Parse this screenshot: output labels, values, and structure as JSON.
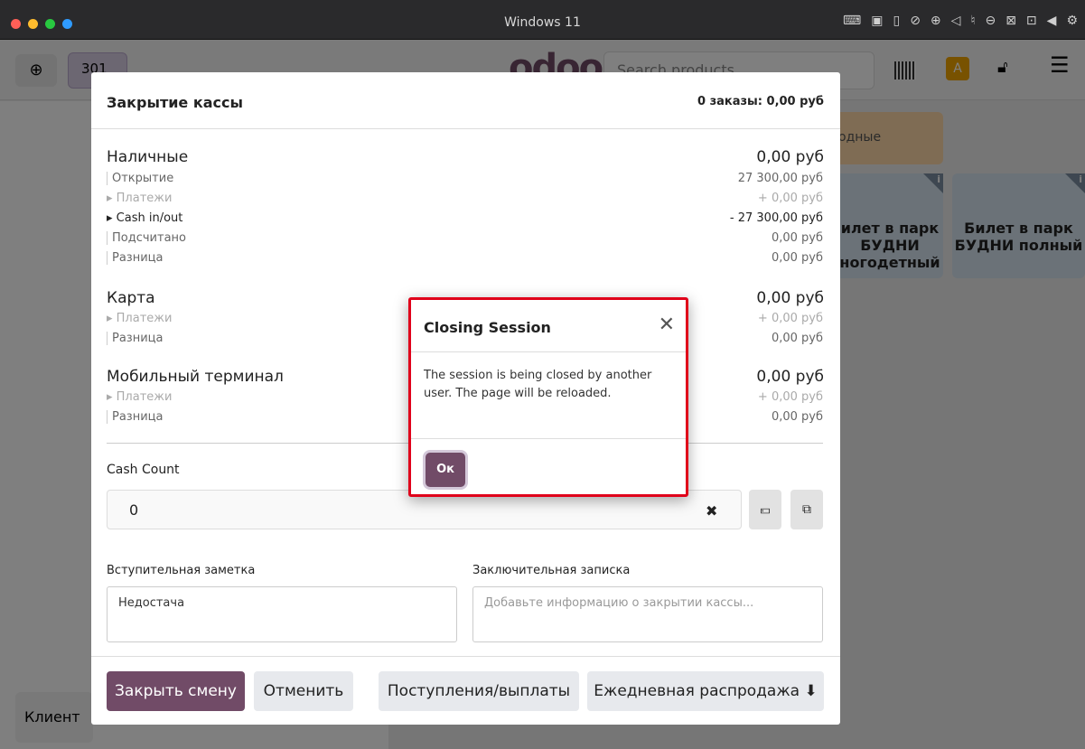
{
  "window": {
    "title": "Windows 11",
    "tray_icons": [
      "keyboard-icon",
      "cpu-icon",
      "usb-icon",
      "network-off-icon",
      "globe-icon",
      "speaker-icon",
      "mic-off-icon",
      "drive-icon",
      "camera-off-icon",
      "screen-share-icon",
      "arrow-left-icon",
      "gear-icon"
    ]
  },
  "pos": {
    "order_number": "301",
    "search_placeholder": "Search products",
    "avatar_letter": "A",
    "client_label": "Клиент",
    "category_chip": "одные",
    "products": [
      {
        "label": "илет в парк\nБУДНИ\nногодетный"
      },
      {
        "label": "Билет в парк\nБУДНИ полный"
      }
    ],
    "info_badge": "i"
  },
  "closing": {
    "title": "Закрытие кассы",
    "summary": "0 заказы: 0,00 руб",
    "cash": {
      "title": "Наличные",
      "total": "0,00 руб",
      "rows": [
        {
          "label": "Открытие",
          "value": "27 300,00 руб"
        },
        {
          "label": "▸ Платежи",
          "value": "+ 0,00 руб"
        },
        {
          "label": "▸ Cash in/out",
          "value": "- 27 300,00 руб"
        },
        {
          "label": "Подсчитано",
          "value": "0,00 руб"
        },
        {
          "label": "Разница",
          "value": "0,00 руб"
        }
      ]
    },
    "card": {
      "title": "Карта",
      "total": "0,00 руб",
      "rows": [
        {
          "label": "▸ Платежи",
          "value": "+ 0,00 руб"
        },
        {
          "label": "Разница",
          "value": "0,00 руб"
        }
      ]
    },
    "mobile": {
      "title": "Мобильный терминал",
      "total": "0,00 руб",
      "rows": [
        {
          "label": "▸ Платежи",
          "value": "+ 0,00 руб"
        },
        {
          "label": "Разница",
          "value": "0,00 руб"
        }
      ]
    },
    "cash_count_label": "Cash Count",
    "cash_count_value": "0",
    "opening_note_label": "Вступительная заметка",
    "opening_note_value": "Недостача",
    "closing_note_label": "Заключительная записка",
    "closing_note_placeholder": "Добавьте информацию о закрытии кассы...",
    "buttons": {
      "close_shift": "Закрыть смену",
      "cancel": "Отменить",
      "cash_in_out": "Поступления/выплаты",
      "daily_sale": "Ежедневная распродажа ⬇"
    }
  },
  "alert": {
    "title": "Closing Session",
    "close_glyph": "✕",
    "message": "The session is being closed by another user. The page will be reloaded.",
    "ok_label": "Ок"
  },
  "colors": {
    "brand": "#714b67",
    "alert_border": "#e0001a"
  }
}
